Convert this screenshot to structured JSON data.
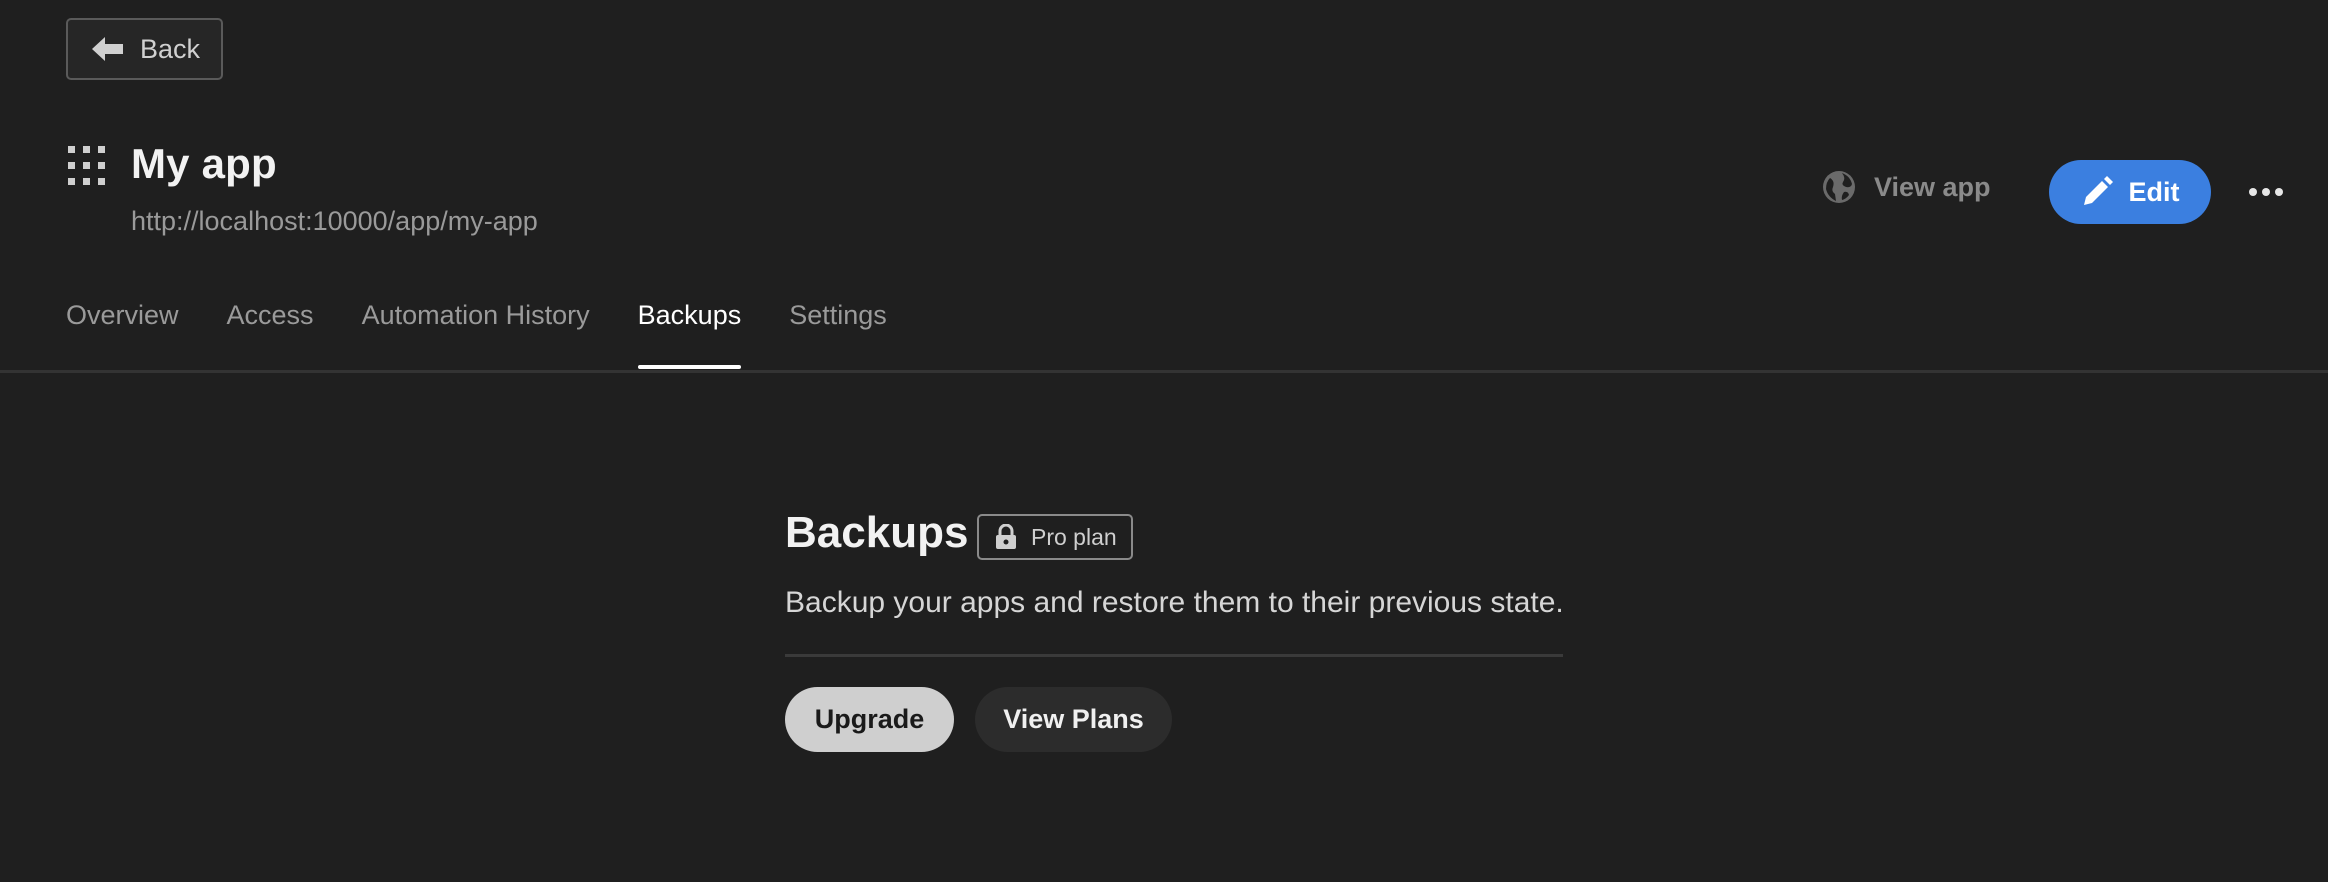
{
  "back": {
    "label": "Back",
    "icon": "arrow-left-icon"
  },
  "app": {
    "title": "My app",
    "url": "http://localhost:10000/app/my-app",
    "icon": "grid-icon"
  },
  "actions": {
    "view_app_label": "View app",
    "view_app_icon": "globe-icon",
    "edit_label": "Edit",
    "edit_icon": "pencil-icon",
    "more_icon": "more-horizontal-icon"
  },
  "tabs": [
    {
      "label": "Overview",
      "active": false
    },
    {
      "label": "Access",
      "active": false
    },
    {
      "label": "Automation History",
      "active": false
    },
    {
      "label": "Backups",
      "active": true
    },
    {
      "label": "Settings",
      "active": false
    }
  ],
  "main": {
    "title": "Backups",
    "badge_label": "Pro plan",
    "badge_icon": "lock-icon",
    "description": "Backup your apps and restore them to their previous state.",
    "upgrade_label": "Upgrade",
    "view_plans_label": "View Plans"
  },
  "colors": {
    "background": "#1f1f1f",
    "accent": "#3b7fe0",
    "muted_text": "#9a9a9a"
  }
}
